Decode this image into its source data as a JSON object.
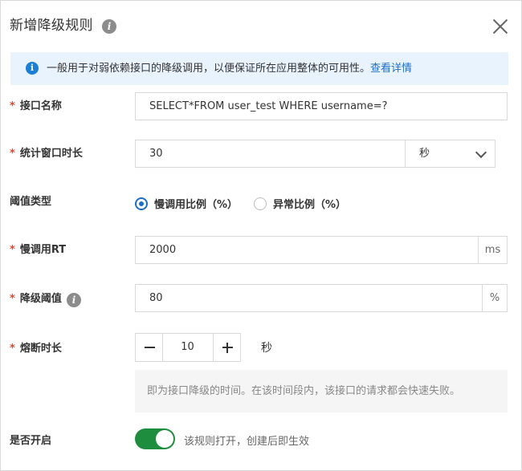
{
  "dialog": {
    "title": "新增降级规则",
    "title_info_icon": "info-icon",
    "close_icon": "close-icon"
  },
  "notice": {
    "icon": "info-icon",
    "text": "一般用于对弱依赖接口的降级调用，以便保证所在应用整体的可用性。",
    "link": "查看详情"
  },
  "fields": {
    "interface_name": {
      "required": "*",
      "label": "接口名称",
      "value": "SELECT*FROM user_test WHERE username=?"
    },
    "window": {
      "required": "*",
      "label": "统计窗口时长",
      "value": "30",
      "unit_select": "秒"
    },
    "threshold_type": {
      "label": "阈值类型",
      "options": [
        {
          "label": "慢调用比例（%）",
          "checked": true
        },
        {
          "label": "异常比例（%）",
          "checked": false
        }
      ]
    },
    "slow_rt": {
      "required": "*",
      "label": "慢调用RT",
      "value": "2000",
      "suffix": "ms"
    },
    "degrade_threshold": {
      "required": "*",
      "label": "降级阈值",
      "info_icon": "info-icon",
      "value": "80",
      "suffix": "%"
    },
    "break_duration": {
      "required": "*",
      "label": "熔断时长",
      "value": "10",
      "unit": "秒",
      "hint": "即为接口降级的时间。在该时间段内，该接口的请求都会快速失败。"
    },
    "enabled": {
      "label": "是否开启",
      "on": true,
      "text": "该规则打开，创建后即生效"
    }
  }
}
